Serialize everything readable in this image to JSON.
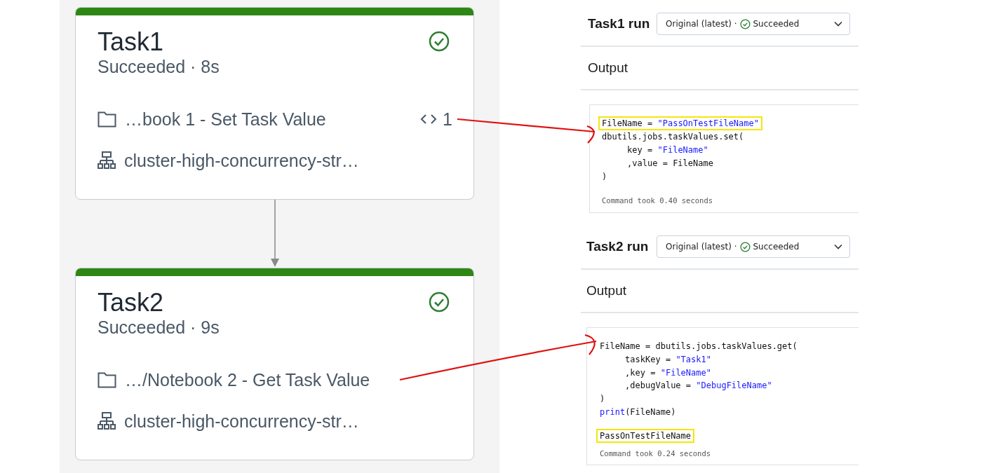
{
  "tasks": [
    {
      "name": "Task1",
      "succeeded": true,
      "status": "Succeeded · 8s",
      "notebook": "…book 1 - Set Task Value",
      "code_count": "1",
      "cluster": "cluster-high-concurrency-str…"
    },
    {
      "name": "Task2",
      "succeeded": true,
      "status": "Succeeded · 9s",
      "notebook": "…/Notebook 2 - Get Task Value",
      "cluster": "cluster-high-concurrency-str…"
    }
  ],
  "runs": [
    {
      "title": "Task1 run",
      "dropdown": {
        "attempt": "Original (latest) ·",
        "succeeded": true,
        "status": "Succeeded"
      },
      "output_heading": "Output",
      "code": [
        {
          "highlighted": true,
          "tokens": [
            {
              "kind": "plain",
              "text": "FileName = "
            },
            {
              "kind": "string",
              "text": "\"PassOnTestFileName\""
            }
          ]
        },
        {
          "highlighted": false,
          "tokens": [
            {
              "kind": "plain",
              "text": "dbutils.jobs.taskValues.set("
            }
          ]
        },
        {
          "highlighted": false,
          "tokens": [
            {
              "kind": "plain",
              "text": "     key = "
            },
            {
              "kind": "string",
              "text": "\"FileName\""
            }
          ]
        },
        {
          "highlighted": false,
          "tokens": [
            {
              "kind": "plain",
              "text": "     ,value = FileName"
            }
          ]
        },
        {
          "highlighted": false,
          "tokens": [
            {
              "kind": "plain",
              "text": ")"
            }
          ]
        }
      ],
      "timing": "Command took 0.40 seconds"
    },
    {
      "title": "Task2 run",
      "dropdown": {
        "attempt": "Original (latest) ·",
        "succeeded": true,
        "status": "Succeeded"
      },
      "output_heading": "Output",
      "code": [
        {
          "highlighted": false,
          "tokens": [
            {
              "kind": "plain",
              "text": "FileName = dbutils.jobs.taskValues.get("
            }
          ]
        },
        {
          "highlighted": false,
          "tokens": [
            {
              "kind": "plain",
              "text": "     taskKey = "
            },
            {
              "kind": "string",
              "text": "\"Task1\""
            }
          ]
        },
        {
          "highlighted": false,
          "tokens": [
            {
              "kind": "plain",
              "text": "     ,key = "
            },
            {
              "kind": "string",
              "text": "\"FileName\""
            }
          ]
        },
        {
          "highlighted": false,
          "tokens": [
            {
              "kind": "plain",
              "text": "     ,debugValue = "
            },
            {
              "kind": "string",
              "text": "\"DebugFileName\""
            }
          ]
        },
        {
          "highlighted": false,
          "tokens": [
            {
              "kind": "plain",
              "text": ")"
            }
          ]
        },
        {
          "highlighted": false,
          "tokens": [
            {
              "kind": "keyword",
              "text": "print"
            },
            {
              "kind": "plain",
              "text": "(FileName)"
            }
          ]
        }
      ],
      "result": {
        "text": "PassOnTestFileName",
        "highlighted": true
      },
      "timing": "Command took 0.24 seconds"
    }
  ]
}
